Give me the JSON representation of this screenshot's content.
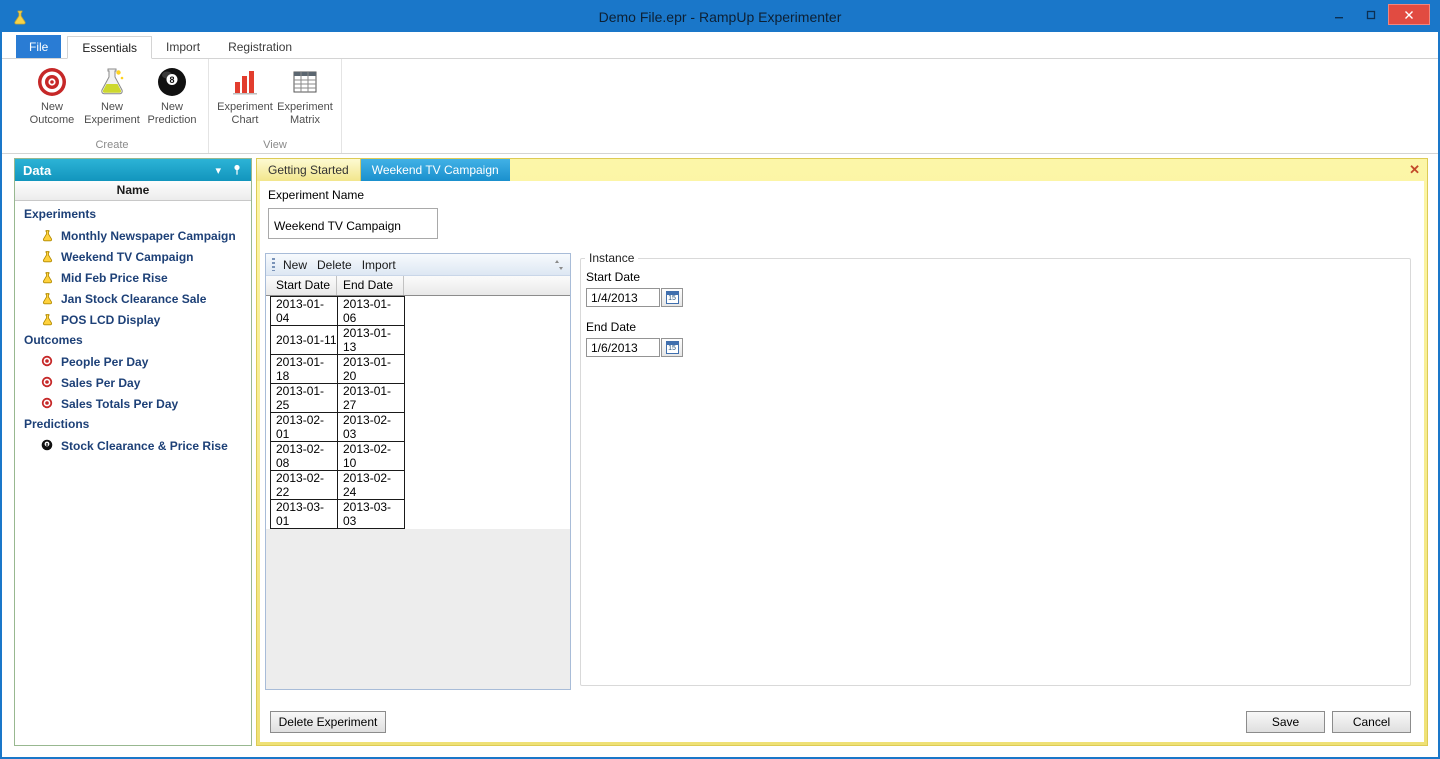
{
  "titlebar": {
    "title": "Demo File.epr - RampUp Experimenter"
  },
  "ribbon": {
    "file_button": "File",
    "tabs": [
      "Essentials",
      "Import",
      "Registration"
    ],
    "groups": [
      {
        "label": "Create",
        "buttons": [
          {
            "line1": "New",
            "line2": "Outcome",
            "icon": "bullseye-icon"
          },
          {
            "line1": "New",
            "line2": "Experiment",
            "icon": "flask-icon"
          },
          {
            "line1": "New",
            "line2": "Prediction",
            "icon": "eight-ball-icon"
          }
        ]
      },
      {
        "label": "View",
        "buttons": [
          {
            "line1": "Experiment",
            "line2": "Chart",
            "icon": "bar-chart-icon"
          },
          {
            "line1": "Experiment",
            "line2": "Matrix",
            "icon": "matrix-icon"
          }
        ]
      }
    ]
  },
  "sidebar": {
    "title": "Data",
    "column_header": "Name",
    "sections": [
      {
        "label": "Experiments",
        "item_icon": "flask-icon",
        "items": [
          "Monthly Newspaper Campaign",
          "Weekend TV Campaign",
          "Mid Feb Price Rise",
          "Jan Stock Clearance Sale",
          "POS LCD Display"
        ]
      },
      {
        "label": "Outcomes",
        "item_icon": "bullseye-icon",
        "items": [
          "People Per Day",
          "Sales Per Day",
          "Sales Totals Per Day"
        ]
      },
      {
        "label": "Predictions",
        "item_icon": "eight-ball-icon",
        "items": [
          "Stock Clearance & Price Rise"
        ]
      }
    ]
  },
  "document": {
    "tabs": [
      "Getting Started",
      "Weekend TV Campaign"
    ],
    "active_tab": "Weekend TV Campaign",
    "experiment_name": {
      "label": "Experiment Name",
      "value": "Weekend TV Campaign"
    },
    "grid": {
      "toolbar": [
        "New",
        "Delete",
        "Import"
      ],
      "columns": [
        "Start Date",
        "End Date"
      ],
      "rows": [
        [
          "2013-01-04",
          "2013-01-06"
        ],
        [
          "2013-01-11",
          "2013-01-13"
        ],
        [
          "2013-01-18",
          "2013-01-20"
        ],
        [
          "2013-01-25",
          "2013-01-27"
        ],
        [
          "2013-02-01",
          "2013-02-03"
        ],
        [
          "2013-02-08",
          "2013-02-10"
        ],
        [
          "2013-02-22",
          "2013-02-24"
        ],
        [
          "2013-03-01",
          "2013-03-03"
        ]
      ]
    },
    "instance": {
      "legend": "Instance",
      "start": {
        "label": "Start Date",
        "value": "1/4/2013"
      },
      "end": {
        "label": "End Date",
        "value": "1/6/2013"
      },
      "picker_day": "15"
    },
    "footer": {
      "delete_experiment": "Delete Experiment",
      "save": "Save",
      "cancel": "Cancel"
    }
  },
  "icons": {
    "chevron_down": "▾",
    "doc_close": "✕"
  },
  "colors": {
    "titlebar_blue": "#1a77c9",
    "file_button_blue": "#2a7cd4",
    "panel_header_teal": "#1295bd",
    "active_doc_tab_blue": "#1a90cd",
    "doc_strip_yellow": "#f2e68c",
    "close_button_red": "#e14b41",
    "tree_text_navy": "#1d4077"
  }
}
